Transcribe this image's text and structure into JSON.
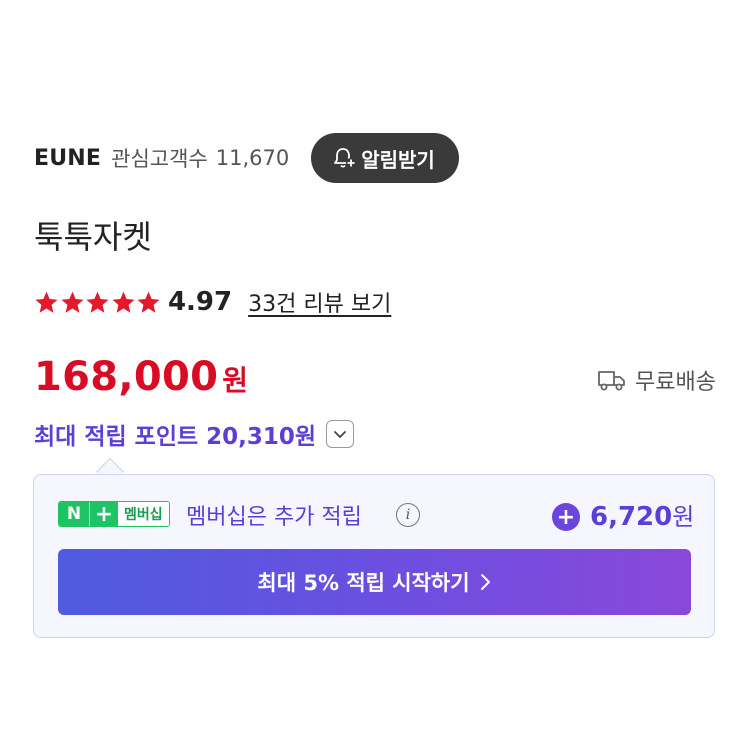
{
  "store": {
    "name": "EUNE",
    "interest_label": "관심고객수",
    "interest_count": "11,670",
    "alarm_button_label": "알림받기"
  },
  "product": {
    "title": "툭툭자켓"
  },
  "rating": {
    "stars_filled": 5,
    "stars_total": 5,
    "score": "4.97",
    "review_link": "33건 리뷰 보기"
  },
  "price": {
    "amount": "168,000",
    "unit": "원"
  },
  "shipping": {
    "label": "무료배송"
  },
  "points": {
    "label": "최대 적립 포인트 20,310원"
  },
  "membership": {
    "badge_n": "N",
    "badge_plus": "+",
    "badge_text": "멤버십",
    "text": "멤버십은 추가 적립",
    "info_glyph": "i",
    "plus_glyph": "+",
    "bonus_amount": "6,720",
    "bonus_unit": "원",
    "cta_label": "최대 5% 적립 시작하기"
  },
  "colors": {
    "price": "#d80c24",
    "points": "#5b3fd6",
    "star": "#e3192e",
    "naver_green": "#1ec364",
    "alarm_bg": "#3a3a3a"
  },
  "icons": {
    "alarm": "bell-plus-icon",
    "star": "star-icon",
    "shipping": "truck-icon",
    "points_toggle": "chevron-down-icon",
    "info": "info-icon",
    "bonus": "plus-circle-icon",
    "cta": "chevron-right-icon"
  }
}
